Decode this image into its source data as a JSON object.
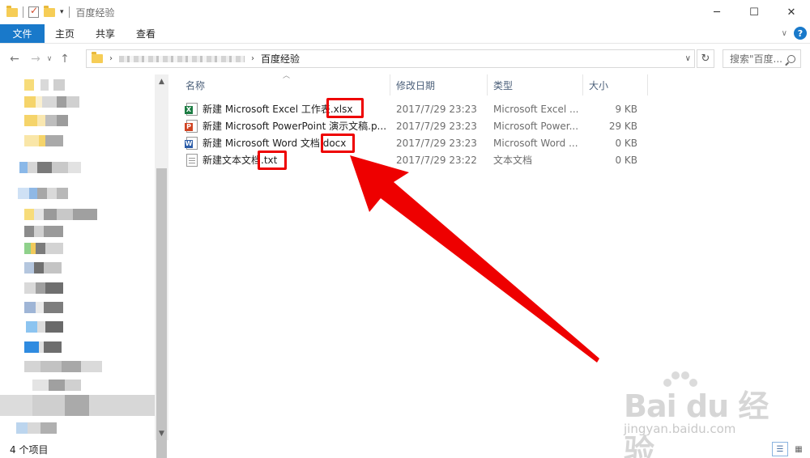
{
  "window": {
    "title": "百度经验",
    "controls": [
      "minimize-icon",
      "maximize-icon",
      "close-icon"
    ]
  },
  "ribbon": {
    "tabs": [
      "文件",
      "主页",
      "共享",
      "查看"
    ]
  },
  "address": {
    "current_folder": "百度经验",
    "search_placeholder": "搜索\"百度..."
  },
  "columns": {
    "name": "名称",
    "date": "修改日期",
    "type": "类型",
    "size": "大小"
  },
  "files": [
    {
      "name": "新建 Microsoft Excel 工作表.xlsx",
      "date": "2017/7/29 23:23",
      "type": "Microsoft Excel ...",
      "size": "9 KB",
      "icon": "excel-icon"
    },
    {
      "name": "新建 Microsoft PowerPoint 演示文稿.p...",
      "date": "2017/7/29 23:23",
      "type": "Microsoft Power...",
      "size": "29 KB",
      "icon": "powerpoint-icon"
    },
    {
      "name": "新建 Microsoft Word 文档.docx",
      "date": "2017/7/29 23:23",
      "type": "Microsoft Word ...",
      "size": "0 KB",
      "icon": "word-icon"
    },
    {
      "name": "新建文本文档.txt",
      "date": "2017/7/29 23:22",
      "type": "文本文档",
      "size": "0 KB",
      "icon": "text-file-icon"
    }
  ],
  "status": {
    "item_count": "4 个项目"
  },
  "annotation": {
    "color": "#ee0000"
  },
  "watermark": {
    "brand": "Bai du 经验",
    "url": "jingyan.baidu.com"
  }
}
